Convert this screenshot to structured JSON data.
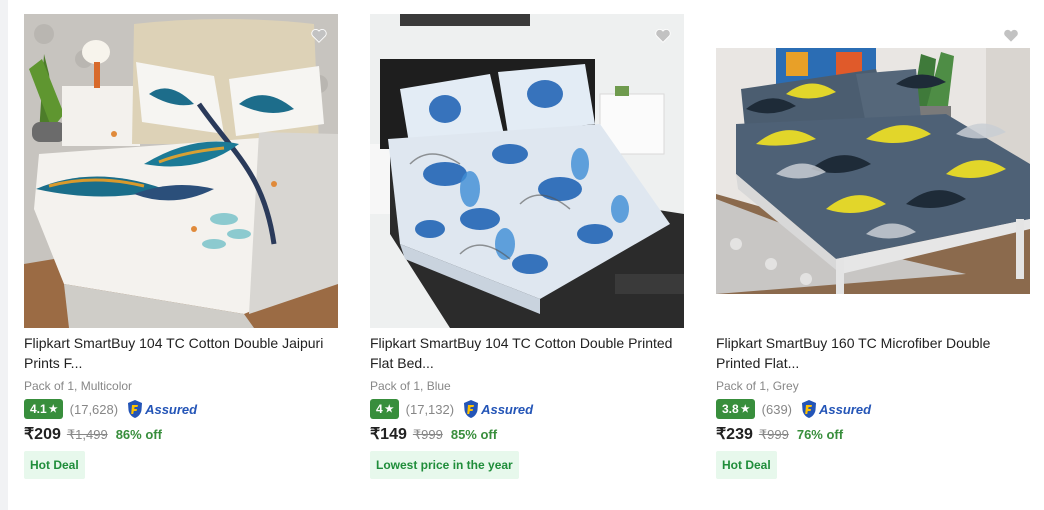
{
  "colors": {
    "rating_green": "#388e3c",
    "deal_bg": "#e7f8ec",
    "deal_text": "#1f8d3a",
    "assured_blue": "#2455b7"
  },
  "products": [
    {
      "title_line1": "Flipkart SmartBuy 104 TC Cotton Double Jaipuri",
      "title_line2": "Prints F...",
      "subtitle": "Pack of 1, Multicolor",
      "rating": "4.1",
      "rating_count": "(17,628)",
      "assured_label": "Assured",
      "price": "₹209",
      "mrp": "₹1,499",
      "discount": "86% off",
      "deal": "Hot Deal",
      "image": "peacock-print-bedsheet"
    },
    {
      "title_line1": "Flipkart SmartBuy 104 TC Cotton Double Printed",
      "title_line2": "Flat Bed...",
      "subtitle": "Pack of 1, Blue",
      "rating": "4",
      "rating_count": "(17,132)",
      "assured_label": "Assured",
      "price": "₹149",
      "mrp": "₹999",
      "discount": "85% off",
      "deal": "Lowest price in the year",
      "image": "blue-floral-bedsheet"
    },
    {
      "title_line1": "Flipkart SmartBuy 160 TC Microfiber Double",
      "title_line2": "Printed Flat...",
      "subtitle": "Pack of 1, Grey",
      "rating": "3.8",
      "rating_count": "(639)",
      "assured_label": "Assured",
      "price": "₹239",
      "mrp": "₹999",
      "discount": "76% off",
      "deal": "Hot Deal",
      "image": "grey-leaf-print-bedsheet"
    }
  ]
}
